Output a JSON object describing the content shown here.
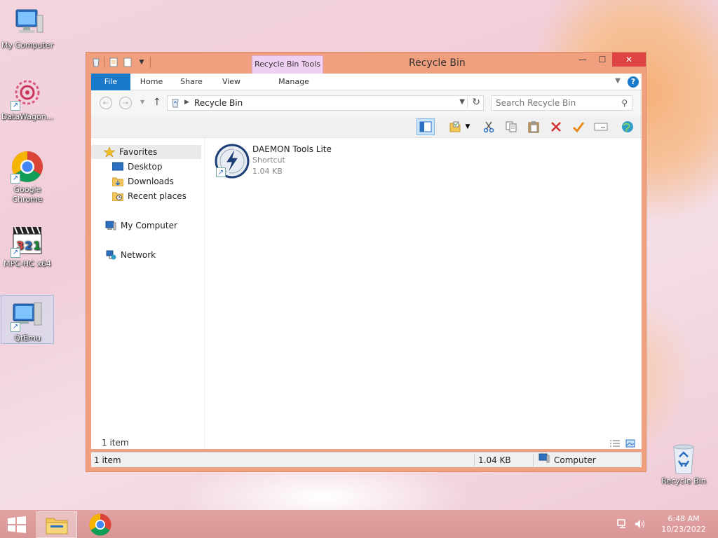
{
  "desktop": {
    "icons": [
      {
        "label": "My Computer"
      },
      {
        "label": "DataWagon..."
      },
      {
        "label": "Google Chrome"
      },
      {
        "label": "MPC-HC x64"
      },
      {
        "label": "QtEmu"
      },
      {
        "label": "Recycle Bin"
      }
    ]
  },
  "window": {
    "title": "Recycle Bin",
    "contextual_tab": "Recycle Bin Tools",
    "controls": {
      "minimize": "—",
      "maximize": "☐",
      "close": "✕"
    }
  },
  "ribbon": {
    "tabs": [
      "File",
      "Home",
      "Share",
      "View",
      "Manage"
    ],
    "help": "?"
  },
  "address": {
    "path": "Recycle Bin",
    "search_placeholder": "Search Recycle Bin"
  },
  "nav_pane": {
    "favorites": "Favorites",
    "items": [
      "Desktop",
      "Downloads",
      "Recent places"
    ],
    "my_computer": "My Computer",
    "network": "Network"
  },
  "files": [
    {
      "name": "DAEMON Tools Lite",
      "type": "Shortcut",
      "size": "1.04 KB"
    }
  ],
  "item_count": "1 item",
  "status": {
    "items": "1 item",
    "size": "1.04 KB",
    "location": "Computer"
  },
  "clock": {
    "time": "6:48 AM",
    "date": "10/23/2022"
  },
  "colors": {
    "window_frame": "#f0a07e",
    "file_tab": "#1979ca",
    "contextual_tab": "#efd0f0",
    "close_button": "#e04343",
    "taskbar": "#d99696"
  }
}
